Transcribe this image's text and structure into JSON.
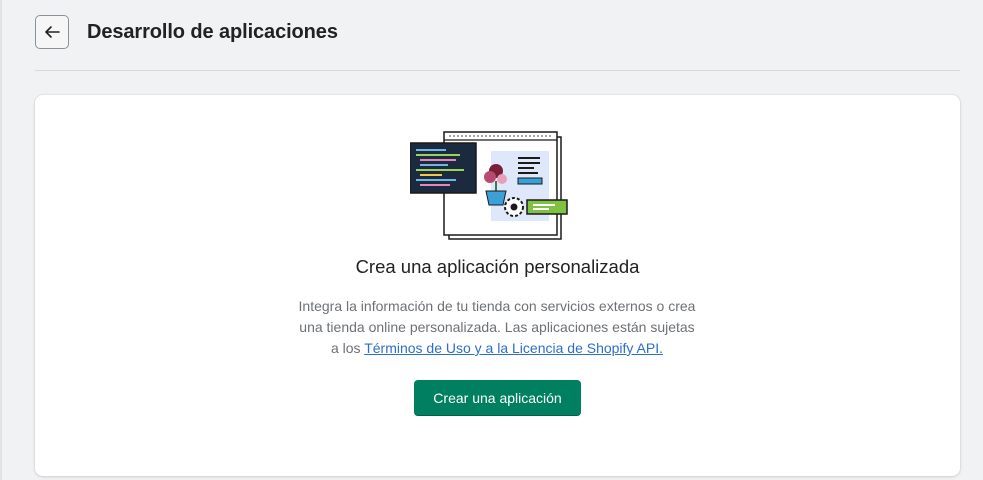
{
  "header": {
    "back_icon": "arrow-left-icon",
    "title": "Desarrollo de aplicaciones"
  },
  "empty_state": {
    "illustration": "app-development-illustration",
    "heading": "Crea una aplicación personalizada",
    "description_prefix": "Integra la información de tu tienda con servicios externos o crea una tienda online personalizada. Las aplicaciones están sujetas a los ",
    "terms_link": "Términos de Uso y a la Licencia de Shopify API.",
    "create_button": "Crear una aplicación"
  },
  "colors": {
    "primary": "#008060",
    "link": "#2c6ecb",
    "page_background": "#f1f2f4",
    "card_background": "#ffffff"
  }
}
